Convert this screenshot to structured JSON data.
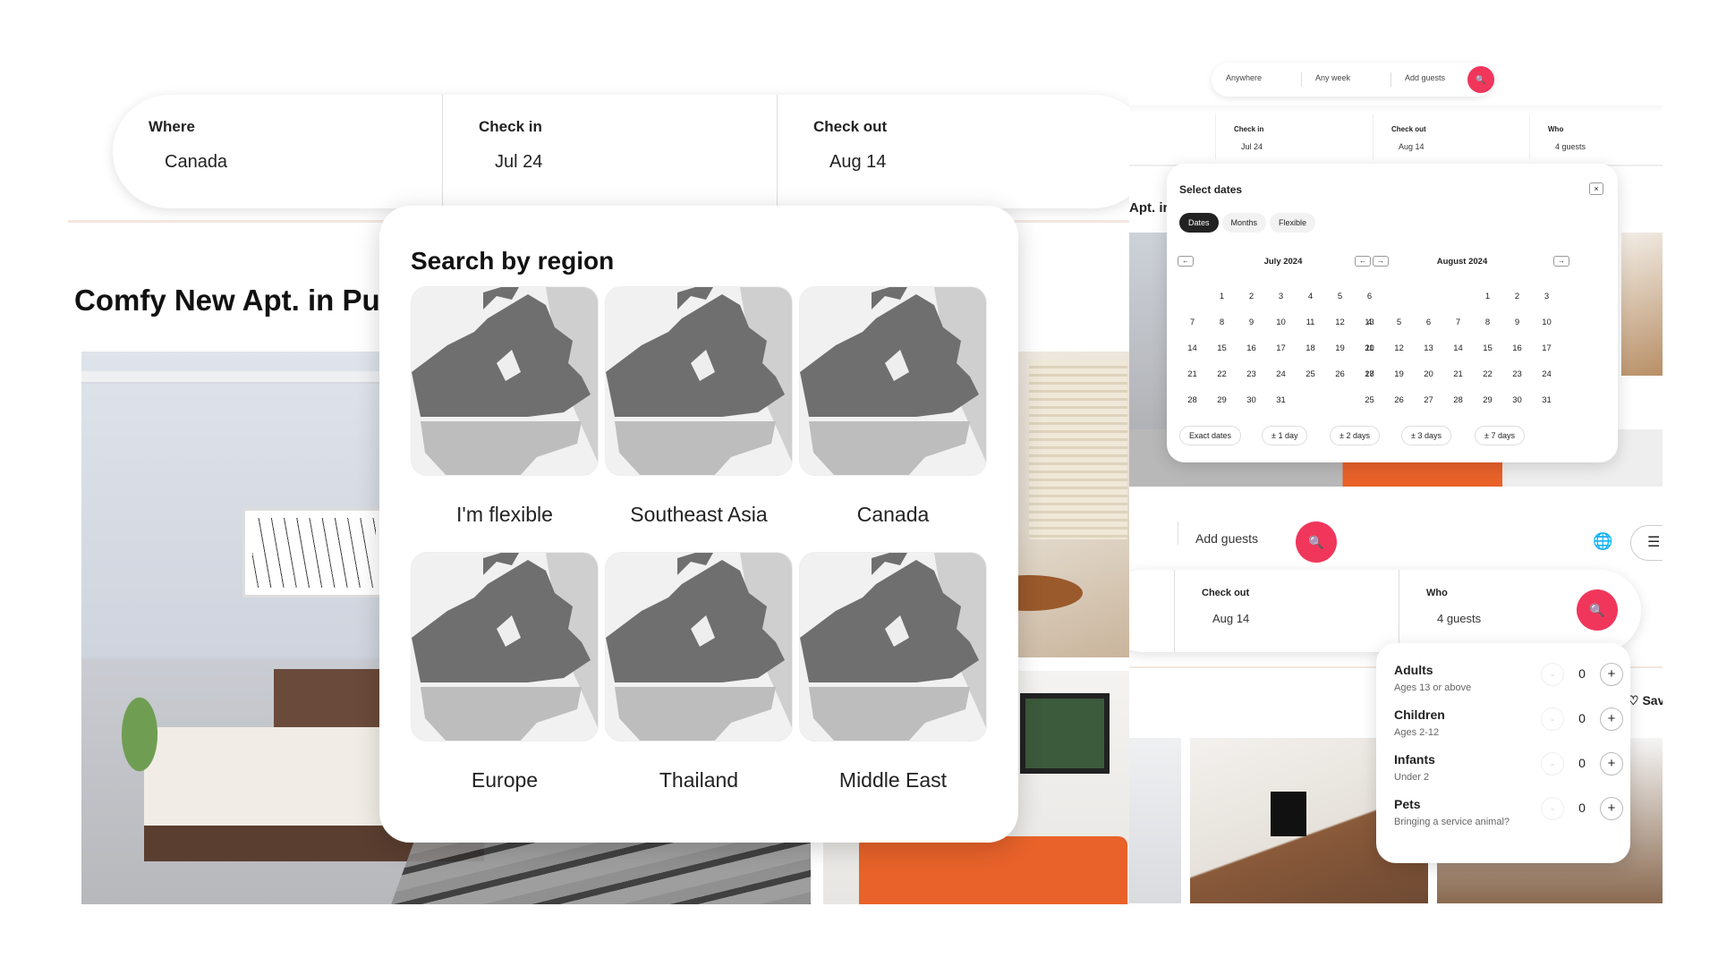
{
  "left": {
    "search": {
      "where_label": "Where",
      "where_value": "Canada",
      "checkin_label": "Check in",
      "checkin_value": "Jul 24",
      "checkout_label": "Check out",
      "checkout_value": "Aug 14"
    },
    "listing_title": "Comfy New Apt. in Pu",
    "region_popup": {
      "title": "Search by region",
      "regions": [
        "I'm flexible",
        "Southeast Asia",
        "Canada",
        "Europe",
        "Thailand",
        "Middle East"
      ]
    }
  },
  "right_top": {
    "mini_search": {
      "anywhere": "Anywhere",
      "any_week": "Any week",
      "add_guests": "Add guests",
      "search_icon": "search-icon"
    },
    "bar": {
      "checkin_label": "Check in",
      "checkin_value": "Jul 24",
      "checkout_label": "Check out",
      "checkout_value": "Aug 14",
      "who_label": "Who",
      "who_value": "4 guests"
    },
    "bg_title": "Apt. in",
    "calendar": {
      "title": "Select dates",
      "close": "×",
      "tabs": [
        "Dates",
        "Months",
        "Flexible"
      ],
      "active_tab": "Dates",
      "prev": "←",
      "next": "→",
      "months": [
        {
          "name": "July 2024",
          "offset": 1,
          "days": 31
        },
        {
          "name": "August 2024",
          "offset": 4,
          "days": 31
        }
      ],
      "chips": [
        "Exact dates",
        "± 1 day",
        "± 2 days",
        "± 3 days",
        "± 7 days"
      ]
    }
  },
  "right_bottom": {
    "add_guests": "Add guests",
    "bar": {
      "checkout_label": "Check out",
      "checkout_value": "Aug 14",
      "who_label": "Who",
      "who_value": "4 guests"
    },
    "save_label": "Sav",
    "guests": [
      {
        "label": "Adults",
        "sub": "Ages 13 or above",
        "count": "0"
      },
      {
        "label": "Children",
        "sub": "Ages 2-12",
        "count": "0"
      },
      {
        "label": "Infants",
        "sub": "Under 2",
        "count": "0"
      },
      {
        "label": "Pets",
        "sub": "Bringing a service animal?",
        "count": "0"
      }
    ],
    "minus": "-",
    "plus": "+"
  },
  "colors": {
    "brand": "#f0365b",
    "text": "#222222"
  }
}
